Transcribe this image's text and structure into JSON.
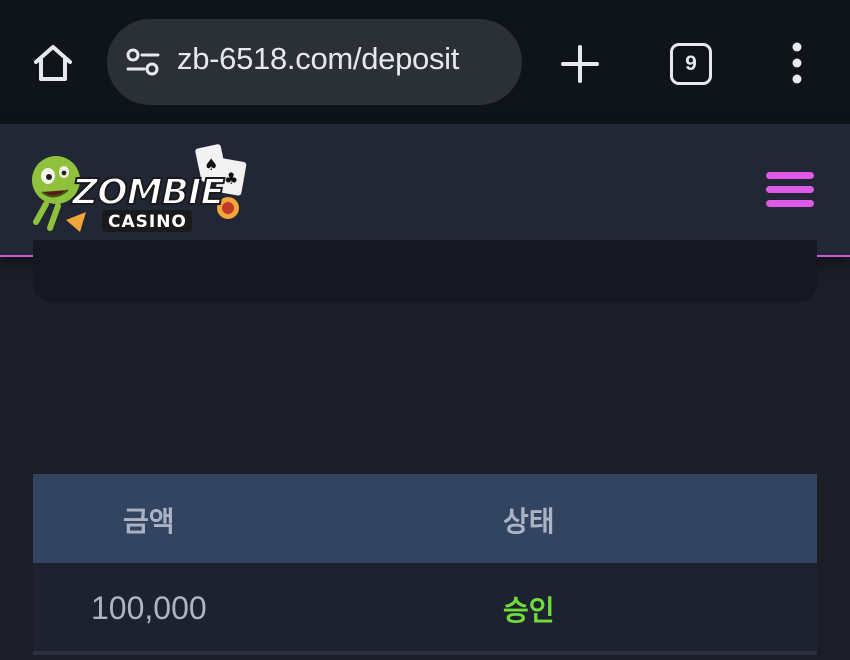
{
  "browser": {
    "url": "zb-6518.com/deposit",
    "tab_count": "9",
    "icons": [
      "home-icon",
      "site-settings-icon",
      "plus-icon",
      "tab-switcher-icon",
      "more-vert-icon"
    ]
  },
  "site": {
    "logo_text_main": "ZOMBIE",
    "logo_text_sub": "CASINO",
    "accent_color": "#e05ae8",
    "menu_icon": "hamburger-menu-icon"
  },
  "table": {
    "headers": [
      "금액",
      "상태"
    ],
    "rows": [
      {
        "amount": "100,000",
        "status": "승인"
      }
    ],
    "status_color": "#6fdc3a"
  }
}
